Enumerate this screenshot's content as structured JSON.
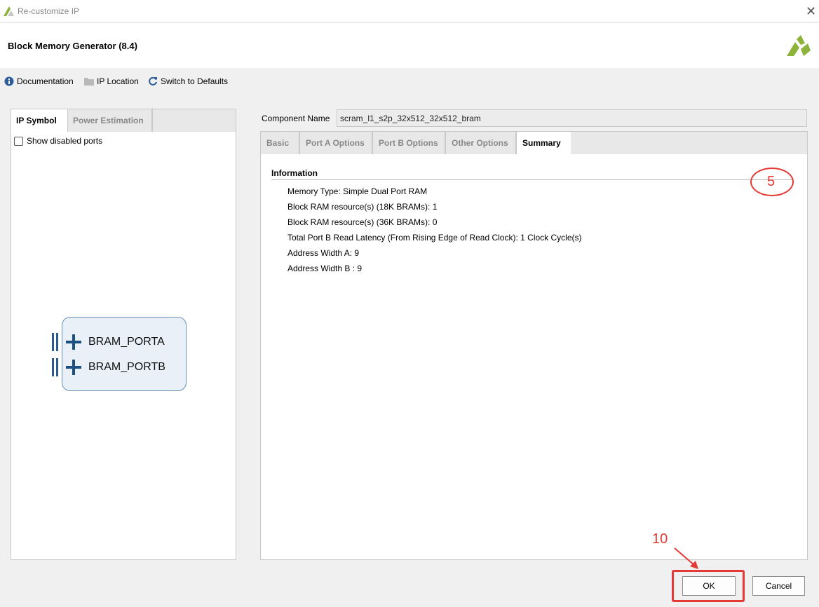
{
  "window": {
    "title": "Re-customize IP"
  },
  "header": {
    "heading": "Block Memory Generator (8.4)"
  },
  "toolbar": {
    "documentation": "Documentation",
    "ip_location": "IP Location",
    "switch_defaults": "Switch to Defaults"
  },
  "left_panel": {
    "tabs": [
      "IP Symbol",
      "Power Estimation"
    ],
    "show_disabled_ports": "Show disabled ports",
    "ports": [
      "BRAM_PORTA",
      "BRAM_PORTB"
    ]
  },
  "component": {
    "label": "Component Name",
    "value": "scram_l1_s2p_32x512_32x512_bram"
  },
  "right_panel": {
    "tabs": [
      "Basic",
      "Port A Options",
      "Port B Options",
      "Other Options",
      "Summary"
    ],
    "active_tab": "Summary",
    "section_title": "Information",
    "info": [
      "Memory Type: Simple Dual Port RAM",
      "Block RAM resource(s) (18K BRAMs): 1",
      "Block RAM resource(s) (36K BRAMs): 0",
      "Total Port B Read Latency (From Rising Edge of Read Clock): 1 Clock Cycle(s)",
      "Address Width A: 9",
      "Address Width B : 9"
    ]
  },
  "annotations": {
    "step_a": "5",
    "step_b": "10"
  },
  "buttons": {
    "ok": "OK",
    "cancel": "Cancel"
  },
  "colors": {
    "annotation": "#e53935",
    "symbol_fill": "#e9f0f8",
    "port_blue": "#1c4f82"
  }
}
